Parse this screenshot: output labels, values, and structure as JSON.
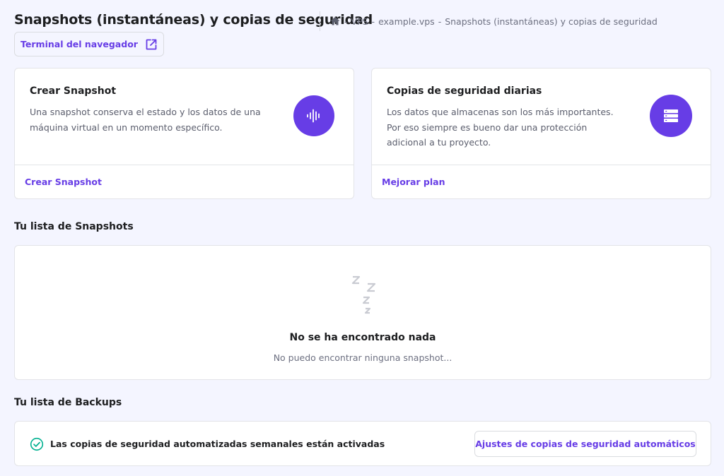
{
  "header": {
    "title": "Snapshots (instantáneas) y copias de seguridad",
    "breadcrumb": {
      "home_icon": "home-icon",
      "separator": "-",
      "items": [
        "VPS",
        "example.vps",
        "Snapshots (instantáneas) y copias de seguridad"
      ]
    },
    "terminal_button": {
      "label": "Terminal del navegador",
      "icon": "external-link-icon"
    }
  },
  "cards": {
    "snapshot": {
      "title": "Crear Snapshot",
      "description": "Una snapshot conserva el estado y los datos de una máquina virtual en un momento específico.",
      "icon": "audio-wave-icon",
      "link_label": "Crear Snapshot"
    },
    "backup": {
      "title": "Copias de seguridad diarias",
      "description": "Los datos que almacenas son los más importantes. Por eso siempre es bueno dar una protección adicional a tu proyecto.",
      "icon": "server-stack-icon",
      "link_label": "Mejorar plan"
    }
  },
  "snapshots": {
    "section_title": "Tu lista de Snapshots",
    "empty_icon": "sleep-zzz-icon",
    "empty_title": "No se ha encontrado nada",
    "empty_description": "No puedo encontrar ninguna snapshot..."
  },
  "backups": {
    "section_title": "Tu lista de Backups",
    "status_icon": "check-circle-icon",
    "status_text": "Las copias de seguridad automatizadas semanales están activadas",
    "settings_button_label": "Ajustes de copias de seguridad automáticos"
  },
  "colors": {
    "accent": "#673de6",
    "background": "#f4f5ff",
    "success": "#00b090",
    "muted_icon": "#c9cbd2"
  }
}
